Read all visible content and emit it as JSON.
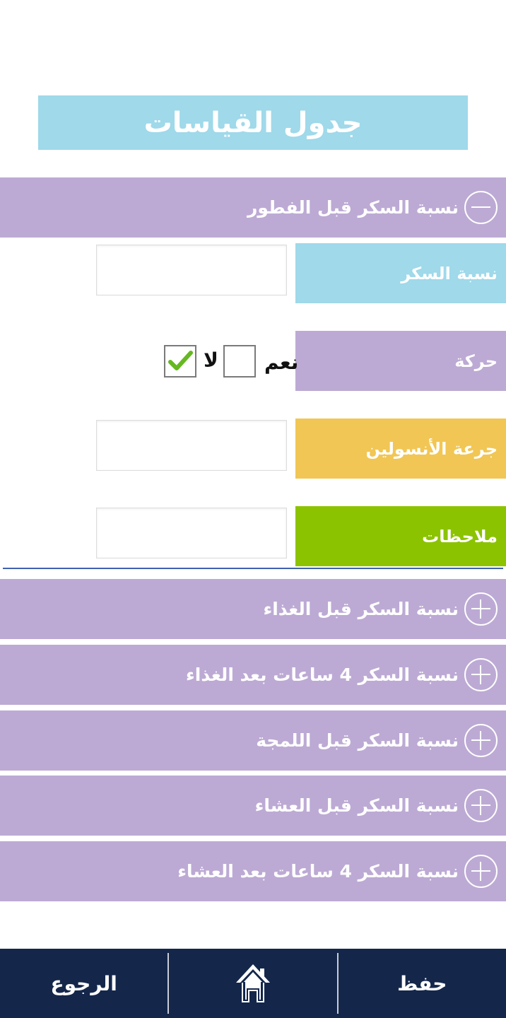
{
  "page": {
    "title": "جدول القياسات"
  },
  "colors": {
    "title_bg": "#9fd9ea",
    "section_bg": "#bcaad4",
    "sugar_label_bg": "#9fd9ea",
    "activity_label_bg": "#bcaad4",
    "insulin_label_bg": "#f1c654",
    "notes_label_bg": "#8cc300",
    "bottom_bar_bg": "#14274b",
    "divider": "#3f61b0",
    "check_mark": "#66b820"
  },
  "sections": [
    {
      "label": "نسبة السكر قبل الفطور",
      "icon": "minus-circle-icon",
      "expanded": true
    },
    {
      "label": "نسبة السكر قبل الغذاء",
      "icon": "plus-circle-icon",
      "expanded": false
    },
    {
      "label": "نسبة السكر 4 ساعات بعد الغذاء",
      "icon": "plus-circle-icon",
      "expanded": false
    },
    {
      "label": "نسبة السكر قبل اللمجة",
      "icon": "plus-circle-icon",
      "expanded": false
    },
    {
      "label": "نسبة السكر قبل العشاء",
      "icon": "plus-circle-icon",
      "expanded": false
    },
    {
      "label": "نسبة السكر 4 ساعات بعد العشاء",
      "icon": "plus-circle-icon",
      "expanded": false
    }
  ],
  "form": {
    "sugar_label": "نسبة السكر",
    "sugar_value": "",
    "activity_label": "حركة",
    "yes_label": "نعم",
    "no_label": "لا",
    "yes_checked": false,
    "no_checked": true,
    "insulin_label": "جرعة الأنسولين",
    "insulin_value": "",
    "notes_label": "ملاحظات",
    "notes_value": ""
  },
  "bottom_bar": {
    "save_label": "حفظ",
    "home_icon": "home-icon",
    "back_label": "الرجوع"
  }
}
